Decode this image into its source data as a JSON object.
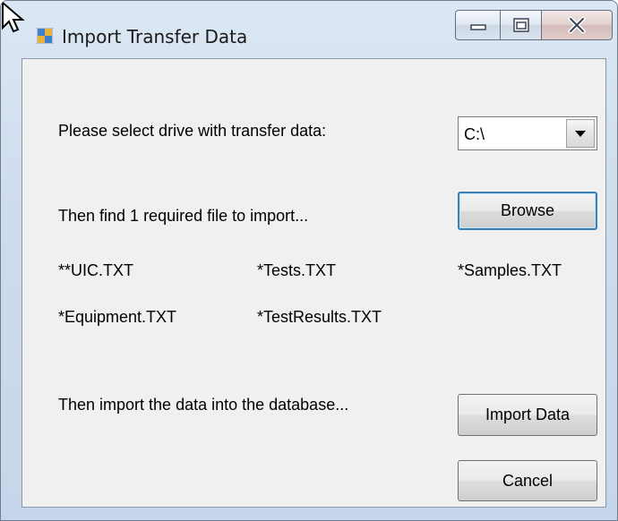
{
  "window": {
    "title": "Import Transfer Data",
    "caption_buttons": {
      "minimize": "minimize-icon",
      "maximize": "maximize-icon",
      "close": "close-icon"
    }
  },
  "form": {
    "drive_prompt": "Please select drive with transfer data:",
    "drive_select": {
      "value": "C:\\"
    },
    "find_prompt": "Then find 1 required file to import...",
    "browse_label": "Browse",
    "files": [
      "**UIC.TXT",
      "*Tests.TXT",
      "*Samples.TXT",
      "*Equipment.TXT",
      "*TestResults.TXT"
    ],
    "import_prompt": "Then import the data into the database...",
    "import_label": "Import Data",
    "cancel_label": "Cancel"
  },
  "colors": {
    "default_button_border": "#3c7fb1",
    "frame": "#c6d6ea"
  }
}
